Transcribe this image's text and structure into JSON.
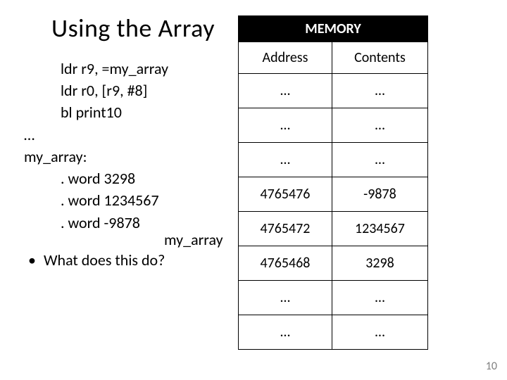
{
  "title": "Using the Array",
  "code": {
    "l1": "ldr r9, =my_array",
    "l2": "ldr r0, [r9, #8]",
    "l3": "bl print10",
    "l4": "…",
    "l5": "my_array:",
    "l6": ". word 3298",
    "l7": ". word 1234567",
    "l8": ". word -9878"
  },
  "bullet_text": "What does this do?",
  "arrow_label": "my_array",
  "memory": {
    "title": "MEMORY",
    "col1": "Address",
    "col2": "Contents",
    "rows": [
      {
        "addr": "…",
        "val": "…"
      },
      {
        "addr": "…",
        "val": "…"
      },
      {
        "addr": "…",
        "val": "…"
      },
      {
        "addr": "4765476",
        "val": "-9878"
      },
      {
        "addr": "4765472",
        "val": "1234567"
      },
      {
        "addr": "4765468",
        "val": "3298"
      },
      {
        "addr": "…",
        "val": "…"
      },
      {
        "addr": "…",
        "val": "…"
      }
    ]
  },
  "page_number": "10"
}
